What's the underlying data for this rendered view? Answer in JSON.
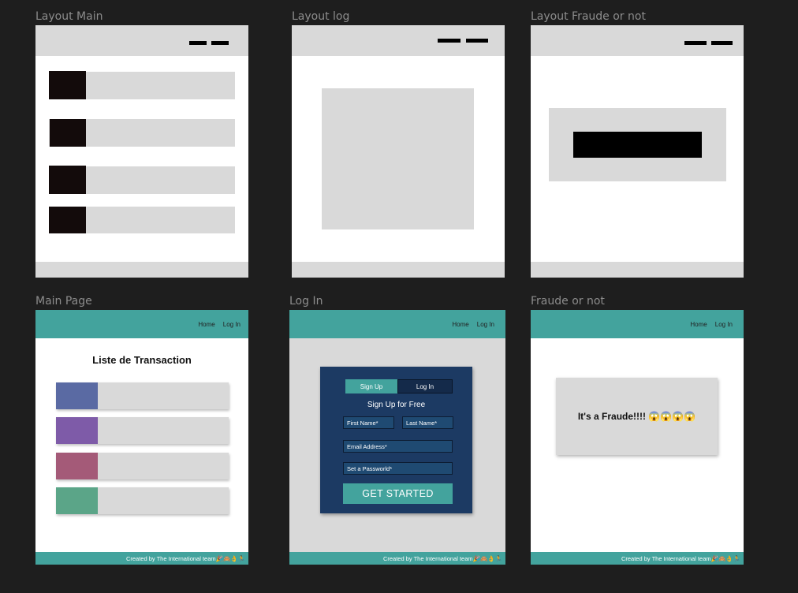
{
  "labels": {
    "layout_main": "Layout Main",
    "layout_log": "Layout log",
    "layout_fraude": "Layout Fraude or not",
    "main_page": "Main Page",
    "log_in": "Log In",
    "fraude_or_not": "Fraude or not"
  },
  "nav": {
    "home": "Home",
    "login": "Log In"
  },
  "footer": {
    "text": "Created by The International team🎉🙈👌🏃"
  },
  "main_page": {
    "title": "Liste de Transaction",
    "swatch_colors": [
      "#5a6aa3",
      "#7e5ba8",
      "#a45a78",
      "#5ba588"
    ]
  },
  "login_form": {
    "tab_signup": "Sign Up",
    "tab_login": "Log In",
    "heading": "Sign Up for Free",
    "first_name_placeholder": "First Name*",
    "last_name_placeholder": "Last Name*",
    "email_placeholder": "Email Address*",
    "password_placeholder": "Set a Passworld*",
    "submit_label": "GET STARTED"
  },
  "fraude": {
    "message": "It's a Fraude!!!! 😱😱😱😱"
  },
  "colors": {
    "canvas": "#1e1e1e",
    "teal": "#43a39d",
    "navy": "#1c3a63",
    "wireframe_gray": "#d9d9d9"
  }
}
